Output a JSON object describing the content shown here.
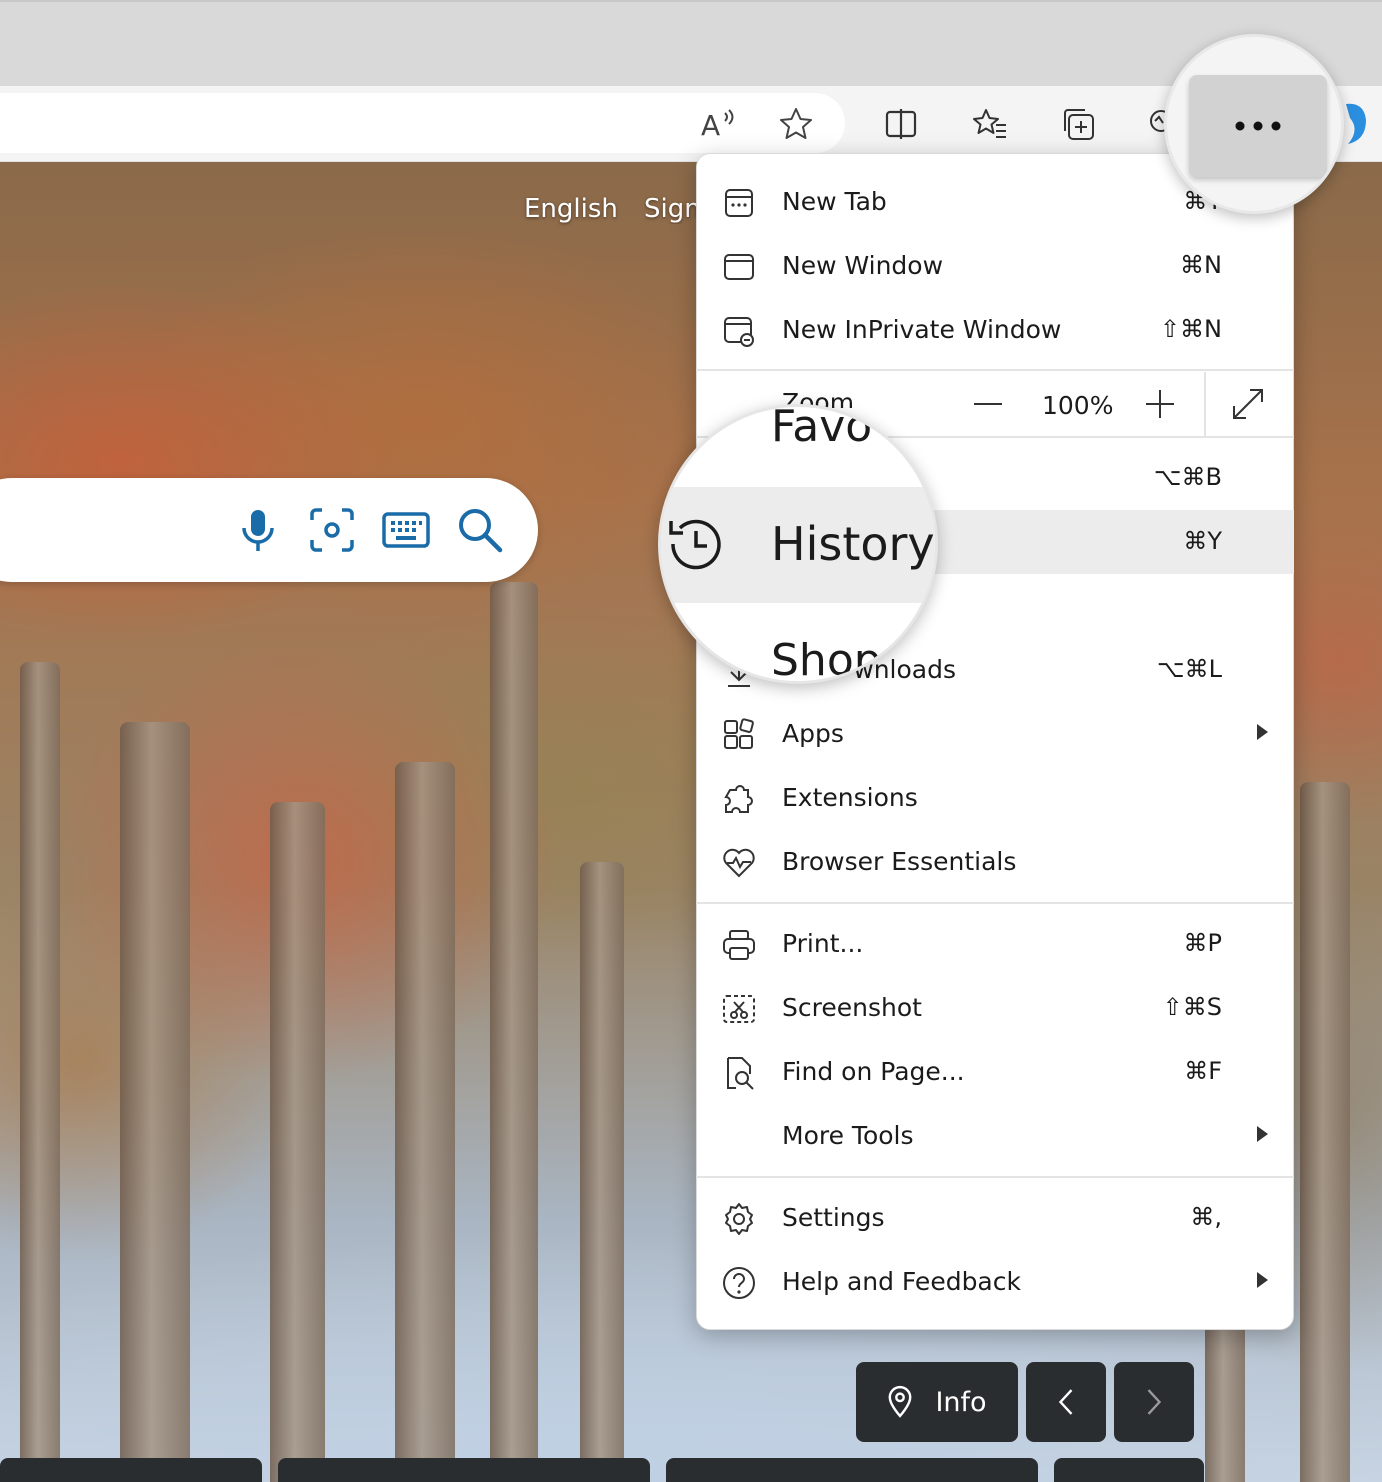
{
  "page": {
    "links": [
      "English",
      "Sign"
    ]
  },
  "toolbar": {
    "buttons": [
      "read-aloud-icon",
      "favorite-star-icon",
      "split-screen-icon",
      "favorites-list-icon",
      "collections-icon",
      "browser-essentials-icon",
      "more-options-icon"
    ]
  },
  "search": {
    "icons": [
      "microphone-icon",
      "visual-search-icon",
      "keyboard-icon",
      "search-icon"
    ]
  },
  "menu": {
    "items": [
      {
        "label": "New Tab",
        "shortcut": "⌘T",
        "icon": "new-tab-icon"
      },
      {
        "label": "New Window",
        "shortcut": "⌘N",
        "icon": "new-window-icon"
      },
      {
        "label": "New InPrivate Window",
        "shortcut": "⇧⌘N",
        "icon": "inprivate-icon"
      },
      {
        "label": "Favorites",
        "shortcut": "⌥⌘B",
        "icon": "favorites-icon"
      },
      {
        "label": "History",
        "shortcut": "⌘Y",
        "icon": "history-icon"
      },
      {
        "label": "Shopping",
        "shortcut": "",
        "icon": "shopping-icon"
      },
      {
        "label": "Downloads",
        "shortcut": "⌥⌘L",
        "icon": "download-icon"
      },
      {
        "label": "Apps",
        "shortcut": "",
        "icon": "apps-icon",
        "submenu": true
      },
      {
        "label": "Extensions",
        "shortcut": "",
        "icon": "extensions-icon"
      },
      {
        "label": "Browser Essentials",
        "shortcut": "",
        "icon": "heartbeat-icon"
      },
      {
        "label": "Print...",
        "shortcut": "⌘P",
        "icon": "print-icon"
      },
      {
        "label": "Screenshot",
        "shortcut": "⇧⌘S",
        "icon": "screenshot-icon"
      },
      {
        "label": "Find on Page...",
        "shortcut": "⌘F",
        "icon": "find-icon"
      },
      {
        "label": "More Tools",
        "shortcut": "",
        "icon": "",
        "submenu": true
      },
      {
        "label": "Settings",
        "shortcut": "⌘,",
        "icon": "settings-icon"
      },
      {
        "label": "Help and Feedback",
        "shortcut": "",
        "icon": "help-icon",
        "submenu": true
      }
    ],
    "zoom": {
      "label": "Zoom",
      "value": "100%"
    }
  },
  "magnifier": {
    "top_text": "Favo",
    "main_text": "History",
    "bottom_text": "Shop"
  },
  "bottom": {
    "info_label": "Info"
  },
  "colors": {
    "accent": "#1a6ca8",
    "menu_highlight": "#ececec",
    "dark_button": "#2a2d30"
  }
}
